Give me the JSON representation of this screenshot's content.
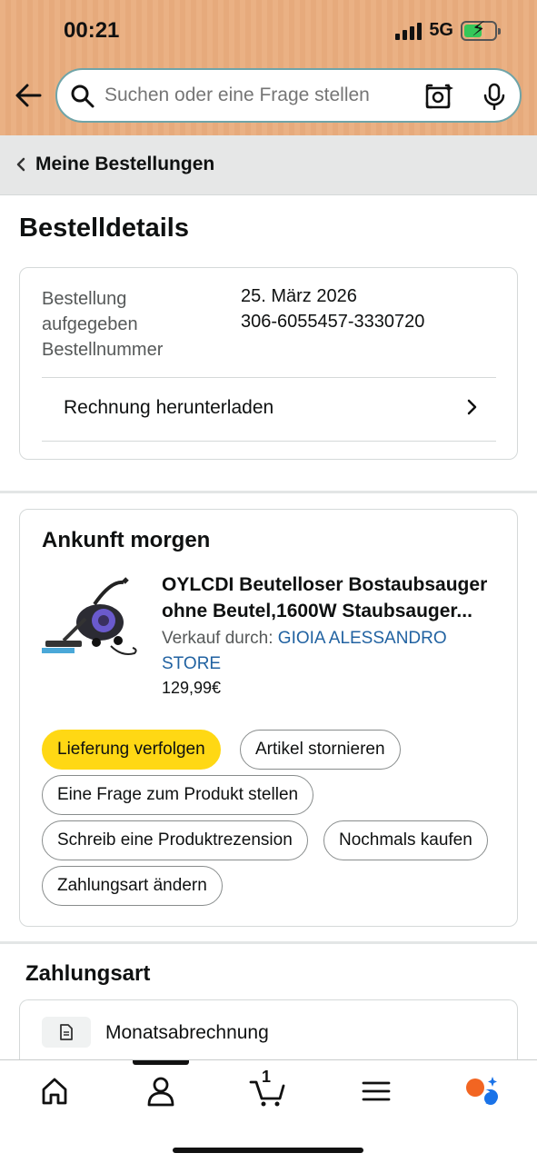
{
  "status_bar": {
    "time": "00:21",
    "network": "5G"
  },
  "search": {
    "placeholder": "Suchen oder eine Frage stellen"
  },
  "breadcrumb": {
    "label": "Meine Bestellungen"
  },
  "page_title": "Bestelldetails",
  "order_info": {
    "labels": [
      "Bestellung",
      "aufgegeben",
      "Bestellnummer"
    ],
    "date": "25. März 2026",
    "order_number": "306-6055457-3330720",
    "invoice_label": "Rechnung herunterladen"
  },
  "shipment": {
    "heading": "Ankunft morgen",
    "product_title": "OYLCDI Beutelloser Bostaubsauger ohne Beutel,1600W Staubsauger...",
    "seller_prefix": "Verkauf durch: ",
    "seller_name": "GIOIA ALESSANDRO STORE",
    "price": "129,99€",
    "actions": {
      "track": "Lieferung verfolgen",
      "cancel": "Artikel stornieren",
      "question": "Eine Frage zum Produkt stellen",
      "review": "Schreib eine Produktrezension",
      "buy_again": "Nochmals kaufen",
      "change_payment": "Zahlungsart ändern"
    }
  },
  "payment": {
    "heading": "Zahlungsart",
    "method": "Monatsabrechnung"
  },
  "bottom_nav": {
    "items": [
      "home-icon",
      "account-icon",
      "cart-icon",
      "menu-icon",
      "assistant-icon"
    ],
    "cart_count": "1"
  },
  "colors": {
    "header": "#eab184",
    "primary_button": "#ffd814",
    "link": "#2162a1",
    "breadcrumb_bg": "#e6e7e7"
  }
}
